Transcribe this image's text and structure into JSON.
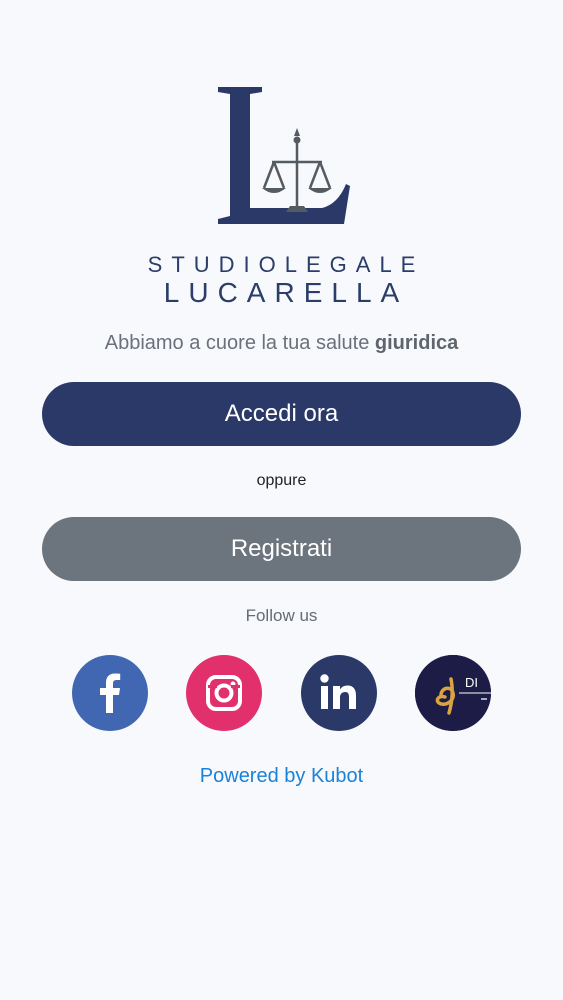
{
  "logo": {
    "line1": "STUDIOLEGALE",
    "line2": "LUCARELLA",
    "icon": "scales-of-justice-icon"
  },
  "tagline": {
    "prefix": "Abbiamo a cuore la tua salute ",
    "bold": "giuridica"
  },
  "buttons": {
    "login": "Accedi ora",
    "separator": "oppure",
    "register": "Registrati"
  },
  "social": {
    "heading": "Follow us",
    "items": [
      {
        "name": "facebook-icon",
        "color": "#4267b2"
      },
      {
        "name": "instagram-icon",
        "color": "#e1306c"
      },
      {
        "name": "linkedin-icon",
        "color": "#2b3968"
      },
      {
        "name": "di-profile-icon",
        "color": "#1d1c46"
      }
    ]
  },
  "footer": {
    "powered": "Powered by Kubot"
  },
  "colors": {
    "primary": "#2b3968",
    "secondary": "#6c757d",
    "link": "#1a82d8",
    "background": "#f7f9fc"
  }
}
